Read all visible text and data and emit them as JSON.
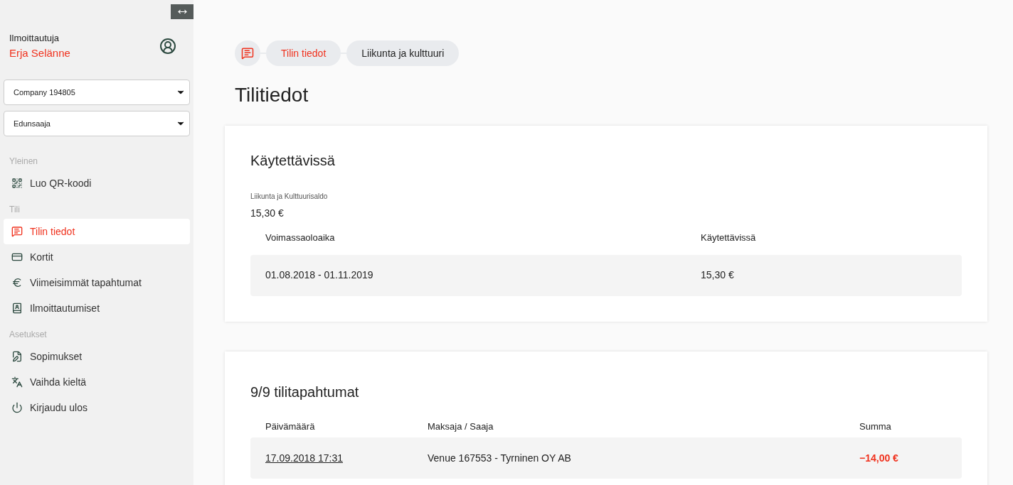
{
  "sidebar": {
    "user_label": "Ilmoittautuja",
    "user_name": "Erja Selänne",
    "selects": [
      {
        "value": "Company 194805"
      },
      {
        "value": "Edunsaaja"
      }
    ],
    "sections": [
      {
        "title": "Yleinen",
        "items": [
          {
            "label": "Luo QR-koodi",
            "selected": false
          }
        ]
      },
      {
        "title": "Tili",
        "items": [
          {
            "label": "Tilin tiedot",
            "selected": true
          },
          {
            "label": "Kortit",
            "selected": false
          },
          {
            "label": "Viimeisimmät tapahtumat",
            "selected": false
          },
          {
            "label": "Ilmoittautumiset",
            "selected": false
          }
        ]
      },
      {
        "title": "Asetukset",
        "items": [
          {
            "label": "Sopimukset",
            "selected": false
          },
          {
            "label": "Vaihda kieltä",
            "selected": false
          },
          {
            "label": "Kirjaudu ulos",
            "selected": false
          }
        ]
      }
    ]
  },
  "breadcrumb": [
    {
      "label": "Tilin tiedot",
      "selected": true
    },
    {
      "label": "Liikunta ja kulttuuri",
      "selected": false
    }
  ],
  "page_title": "Tilitiedot",
  "available": {
    "title": "Käytettävissä",
    "balance_label": "Liikunta ja Kulttuurisaldo",
    "balance": "15,30 €",
    "columns": [
      "Voimassaoloaika",
      "Käytettävissä"
    ],
    "rows": [
      [
        "01.08.2018 - 01.11.2019",
        "15,30 €"
      ]
    ]
  },
  "transactions": {
    "title": "9/9 tilitapahtumat",
    "columns": [
      "Päivämäärä",
      "Maksaja / Saaja",
      "Summa"
    ],
    "rows": [
      {
        "date": "17.09.2018 17:31",
        "party": "Venue 167553 - Tyrninen OY AB",
        "amount": "−14,00 €",
        "negative": true
      }
    ]
  }
}
